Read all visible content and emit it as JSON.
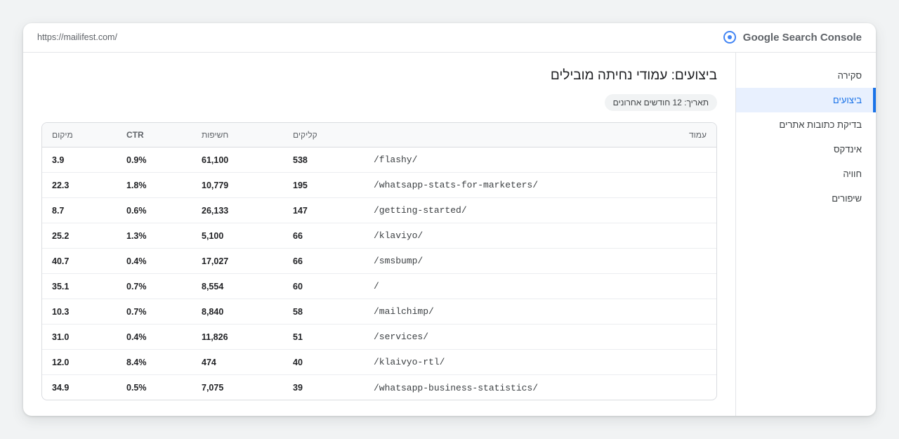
{
  "topbar": {
    "url": "https://mailifest.com/",
    "brand_name": "Google Search Console",
    "brand_icon": "radio-target-icon"
  },
  "sidebar": {
    "items": [
      {
        "label": "סקירה",
        "active": false
      },
      {
        "label": "ביצועים",
        "active": true
      },
      {
        "label": "בדיקת כתובות אתרים",
        "active": false
      },
      {
        "label": "אינדקס",
        "active": false
      },
      {
        "label": "חוויה",
        "active": false
      },
      {
        "label": "שיפורים",
        "active": false
      }
    ]
  },
  "main": {
    "title": "ביצועים: עמודי נחיתה מובילים",
    "date_chip": "תאריך: 12 חודשים אחרונים"
  },
  "table": {
    "headers": {
      "position": "מיקום",
      "ctr": "CTR",
      "impressions": "חשיפות",
      "clicks": "קליקים",
      "page": "עמוד"
    },
    "rows": [
      {
        "position": "3.9",
        "ctr": "0.9%",
        "impressions": "61,100",
        "clicks": "538",
        "page": "/flashy/"
      },
      {
        "position": "22.3",
        "ctr": "1.8%",
        "impressions": "10,779",
        "clicks": "195",
        "page": "/whatsapp-stats-for-marketers/"
      },
      {
        "position": "8.7",
        "ctr": "0.6%",
        "impressions": "26,133",
        "clicks": "147",
        "page": "/getting-started/"
      },
      {
        "position": "25.2",
        "ctr": "1.3%",
        "impressions": "5,100",
        "clicks": "66",
        "page": "/klaviyo/"
      },
      {
        "position": "40.7",
        "ctr": "0.4%",
        "impressions": "17,027",
        "clicks": "66",
        "page": "/smsbump/"
      },
      {
        "position": "35.1",
        "ctr": "0.7%",
        "impressions": "8,554",
        "clicks": "60",
        "page": "/"
      },
      {
        "position": "10.3",
        "ctr": "0.7%",
        "impressions": "8,840",
        "clicks": "58",
        "page": "/mailchimp/"
      },
      {
        "position": "31.0",
        "ctr": "0.4%",
        "impressions": "11,826",
        "clicks": "51",
        "page": "/services/"
      },
      {
        "position": "12.0",
        "ctr": "8.4%",
        "impressions": "474",
        "clicks": "40",
        "page": "/klaivyo-rtl/"
      },
      {
        "position": "34.9",
        "ctr": "0.5%",
        "impressions": "7,075",
        "clicks": "39",
        "page": "/whatsapp-business-statistics/"
      }
    ]
  },
  "colors": {
    "accent": "#1a73e8",
    "active_bg": "#e8f0fe",
    "brand_icon": "#4285f4",
    "border": "#dadce0"
  }
}
